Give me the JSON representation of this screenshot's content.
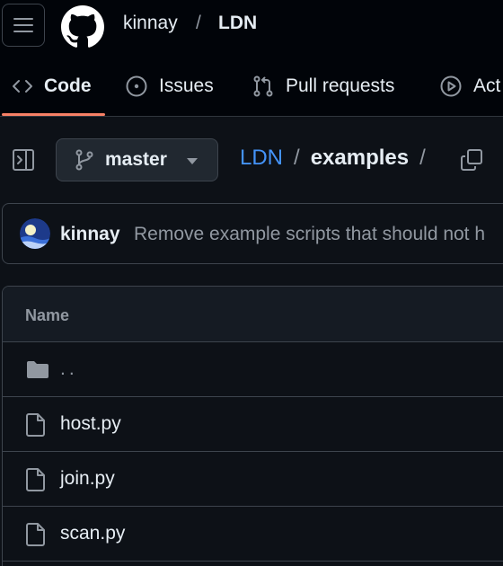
{
  "header": {
    "owner": "kinnay",
    "separator": "/",
    "repo": "LDN"
  },
  "tabs": [
    {
      "label": "Code",
      "icon": "code-icon",
      "selected": true
    },
    {
      "label": "Issues",
      "icon": "issue-opened-icon"
    },
    {
      "label": "Pull requests",
      "icon": "git-pull-request-icon"
    },
    {
      "label": "Act",
      "icon": "play-icon"
    }
  ],
  "toolbar": {
    "branch": "master",
    "path": {
      "repo": "LDN",
      "folder": "examples",
      "sep": "/"
    }
  },
  "commit": {
    "author": "kinnay",
    "message": "Remove example scripts that should not h"
  },
  "file_table": {
    "header": "Name",
    "parent": "..",
    "files": [
      "host.py",
      "join.py",
      "scan.py"
    ]
  },
  "colors": {
    "background": "#0d1117",
    "link": "#4493f8",
    "tab_underline": "#f78166",
    "border": "#3d444d"
  }
}
